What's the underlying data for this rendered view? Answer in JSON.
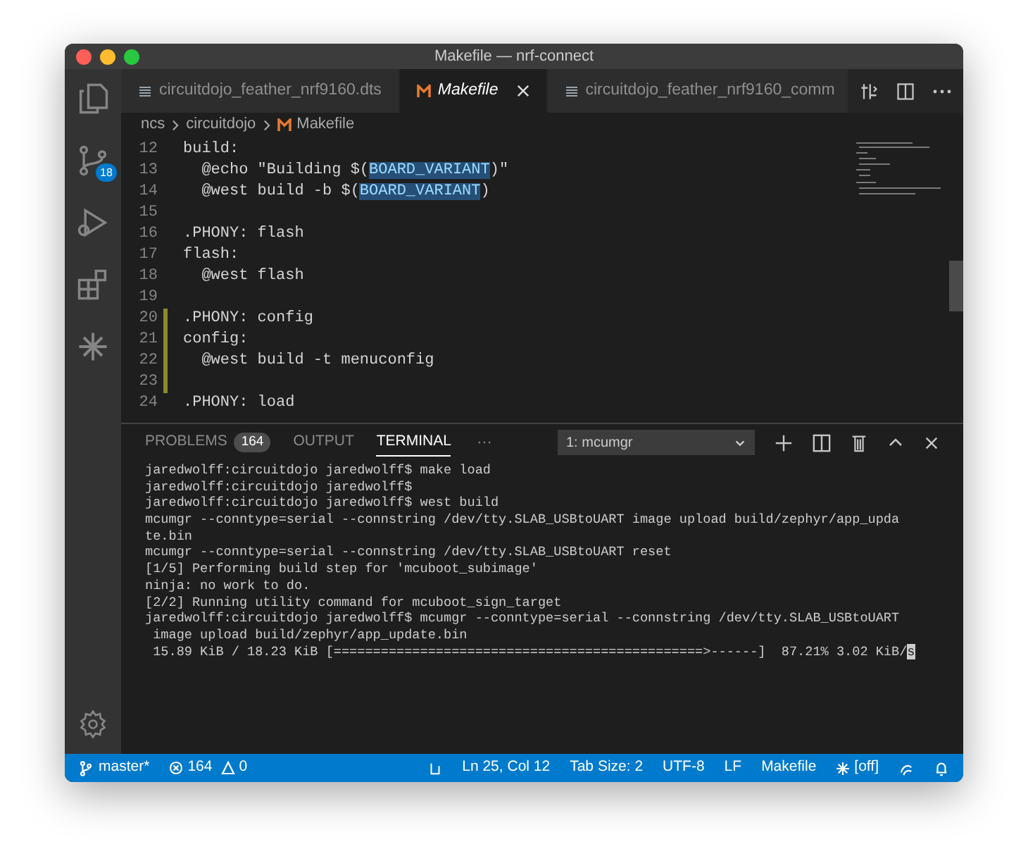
{
  "window": {
    "title": "Makefile — nrf-connect"
  },
  "activity_bar": [
    {
      "kind": "explorer"
    },
    {
      "kind": "scm",
      "badge": "18"
    },
    {
      "kind": "debug"
    },
    {
      "kind": "extensions"
    },
    {
      "kind": "nordic"
    }
  ],
  "tabs": [
    {
      "label": "circuitdojo_feather_nrf9160.dts",
      "selected": false,
      "kind": "lines"
    },
    {
      "label": "Makefile",
      "selected": true,
      "kind": "makefile"
    },
    {
      "label": "circuitdojo_feather_nrf9160_comm",
      "selected": false,
      "kind": "lines"
    }
  ],
  "breadcrumb": [
    {
      "label": "ncs",
      "kind": "folder"
    },
    {
      "label": "circuitdojo",
      "kind": "folder"
    },
    {
      "label": "Makefile",
      "kind": "makefile"
    }
  ],
  "editor": {
    "lines": [
      {
        "number": "12",
        "modified": false,
        "segments": [
          {
            "text": "build:",
            "highlighted": false
          }
        ]
      },
      {
        "number": "13",
        "modified": false,
        "segments": [
          {
            "text": "  @echo \"Building $(",
            "highlighted": false
          },
          {
            "text": "BOARD_VARIANT",
            "highlighted": true
          },
          {
            "text": ")\"",
            "highlighted": false
          }
        ]
      },
      {
        "number": "14",
        "modified": false,
        "segments": [
          {
            "text": "  @west build -b $(",
            "highlighted": false
          },
          {
            "text": "BOARD_VARIANT",
            "highlighted": true
          },
          {
            "text": ")",
            "highlighted": false
          }
        ]
      },
      {
        "number": "15",
        "modified": false
      },
      {
        "number": "16",
        "modified": false,
        "segments": [
          {
            "text": ".PHONY: flash",
            "highlighted": false
          }
        ]
      },
      {
        "number": "17",
        "modified": false,
        "segments": [
          {
            "text": "flash:",
            "highlighted": false
          }
        ]
      },
      {
        "number": "18",
        "modified": false,
        "segments": [
          {
            "text": "  @west flash",
            "highlighted": false
          }
        ]
      },
      {
        "number": "19",
        "modified": false
      },
      {
        "number": "20",
        "modified": true,
        "segments": [
          {
            "text": ".PHONY: config",
            "highlighted": false
          }
        ]
      },
      {
        "number": "21",
        "modified": true,
        "segments": [
          {
            "text": "config:",
            "highlighted": false
          }
        ]
      },
      {
        "number": "22",
        "modified": true,
        "segments": [
          {
            "text": "  @west build -t menuconfig",
            "highlighted": false
          }
        ]
      },
      {
        "number": "23",
        "modified": true
      },
      {
        "number": "24",
        "modified": false,
        "segments": [
          {
            "text": ".PHONY: load",
            "highlighted": false
          }
        ]
      }
    ]
  },
  "panel": {
    "tabs": [
      {
        "label": "PROBLEMS",
        "selected": false,
        "badge": "164"
      },
      {
        "label": "OUTPUT",
        "selected": false
      },
      {
        "label": "TERMINAL",
        "selected": true
      }
    ],
    "more": "···",
    "terminal_select": "1: mcumgr",
    "terminal_lines": [
      "jaredwolff:circuitdojo jaredwolff$ make load",
      "jaredwolff:circuitdojo jaredwolff$",
      "jaredwolff:circuitdojo jaredwolff$ west build",
      "mcumgr --conntype=serial --connstring /dev/tty.SLAB_USBtoUART image upload build/zephyr/app_upda",
      "te.bin",
      "mcumgr --conntype=serial --connstring /dev/tty.SLAB_USBtoUART reset",
      "[1/5] Performing build step for 'mcuboot_subimage'",
      "ninja: no work to do.",
      "[2/2] Running utility command for mcuboot_sign_target",
      "jaredwolff:circuitdojo jaredwolff$ mcumgr --conntype=serial --connstring /dev/tty.SLAB_USBtoUART",
      " image upload build/zephyr/app_update.bin",
      " 15.89 KiB / 18.23 KiB [===============================================>------]  87.21% 3.02 KiB/s"
    ]
  },
  "status_bar": {
    "branch": "master*",
    "errors": "164",
    "warnings": "0",
    "position": "Ln 25, Col 12",
    "tab_size": "Tab Size: 2",
    "encoding": "UTF-8",
    "eol": "LF",
    "language": "Makefile",
    "nordic": "[off]"
  }
}
